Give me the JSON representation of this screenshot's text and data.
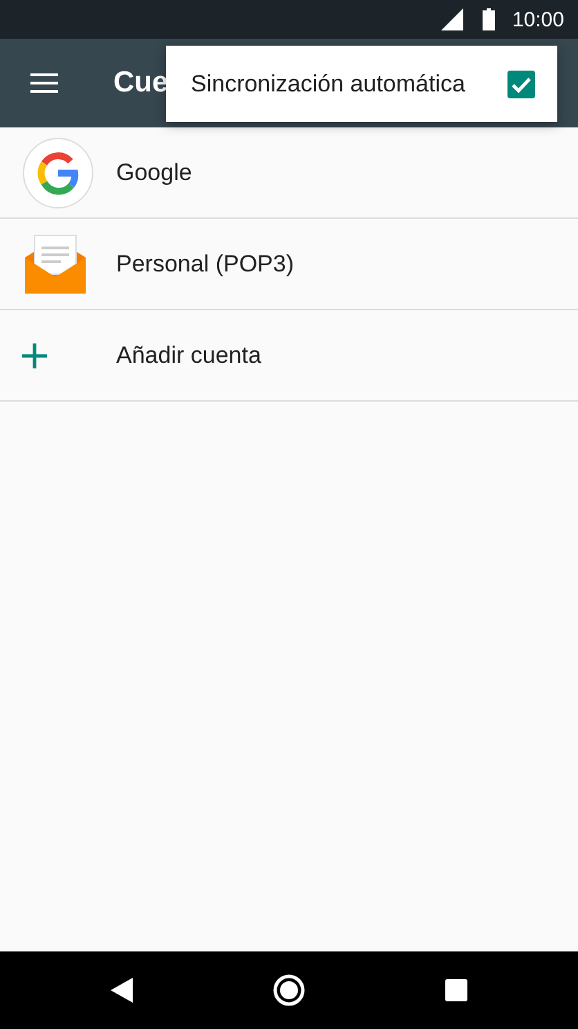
{
  "status_bar": {
    "time": "10:00"
  },
  "app_bar": {
    "title": "Cue"
  },
  "menu": {
    "items": [
      {
        "label": "Sincronización automática",
        "checked": true
      }
    ]
  },
  "accounts": [
    {
      "kind": "google",
      "label": "Google"
    },
    {
      "kind": "email",
      "label": "Personal (POP3)"
    },
    {
      "kind": "add",
      "label": "Añadir cuenta"
    }
  ]
}
